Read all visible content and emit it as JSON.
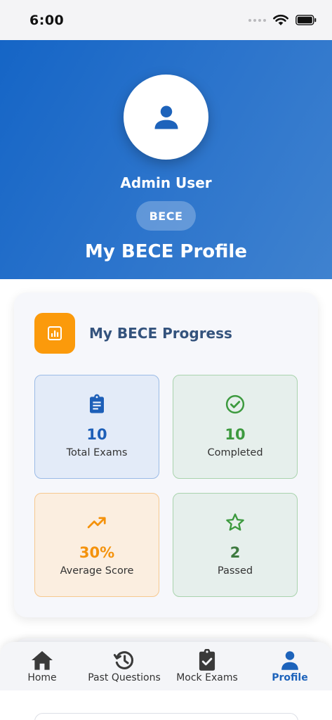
{
  "status_bar": {
    "time": "6:00"
  },
  "profile": {
    "name": "Admin User",
    "level": "BECE",
    "title": "My BECE Profile"
  },
  "progress": {
    "title": "My BECE Progress",
    "stats": [
      {
        "value": "10",
        "label": "Total Exams",
        "icon": "clipboard-icon",
        "color": "#1d5fb8"
      },
      {
        "value": "10",
        "label": "Completed",
        "icon": "check-circle-icon",
        "color": "#3d9a3f"
      },
      {
        "value": "30%",
        "label": "Average Score",
        "icon": "trending-up-icon",
        "color": "#f4920c"
      },
      {
        "value": "2",
        "label": "Passed",
        "icon": "star-outline-icon",
        "color": "#3d7a3f"
      }
    ]
  },
  "nav": {
    "items": [
      {
        "label": "Home",
        "icon": "home-icon"
      },
      {
        "label": "Past Questions",
        "icon": "history-icon"
      },
      {
        "label": "Mock Exams",
        "icon": "clipboard-check-icon"
      },
      {
        "label": "Profile",
        "icon": "person-icon",
        "active": true
      }
    ]
  },
  "colors": {
    "primary": "#1d63bb",
    "accent_orange": "#fb9a0b"
  }
}
